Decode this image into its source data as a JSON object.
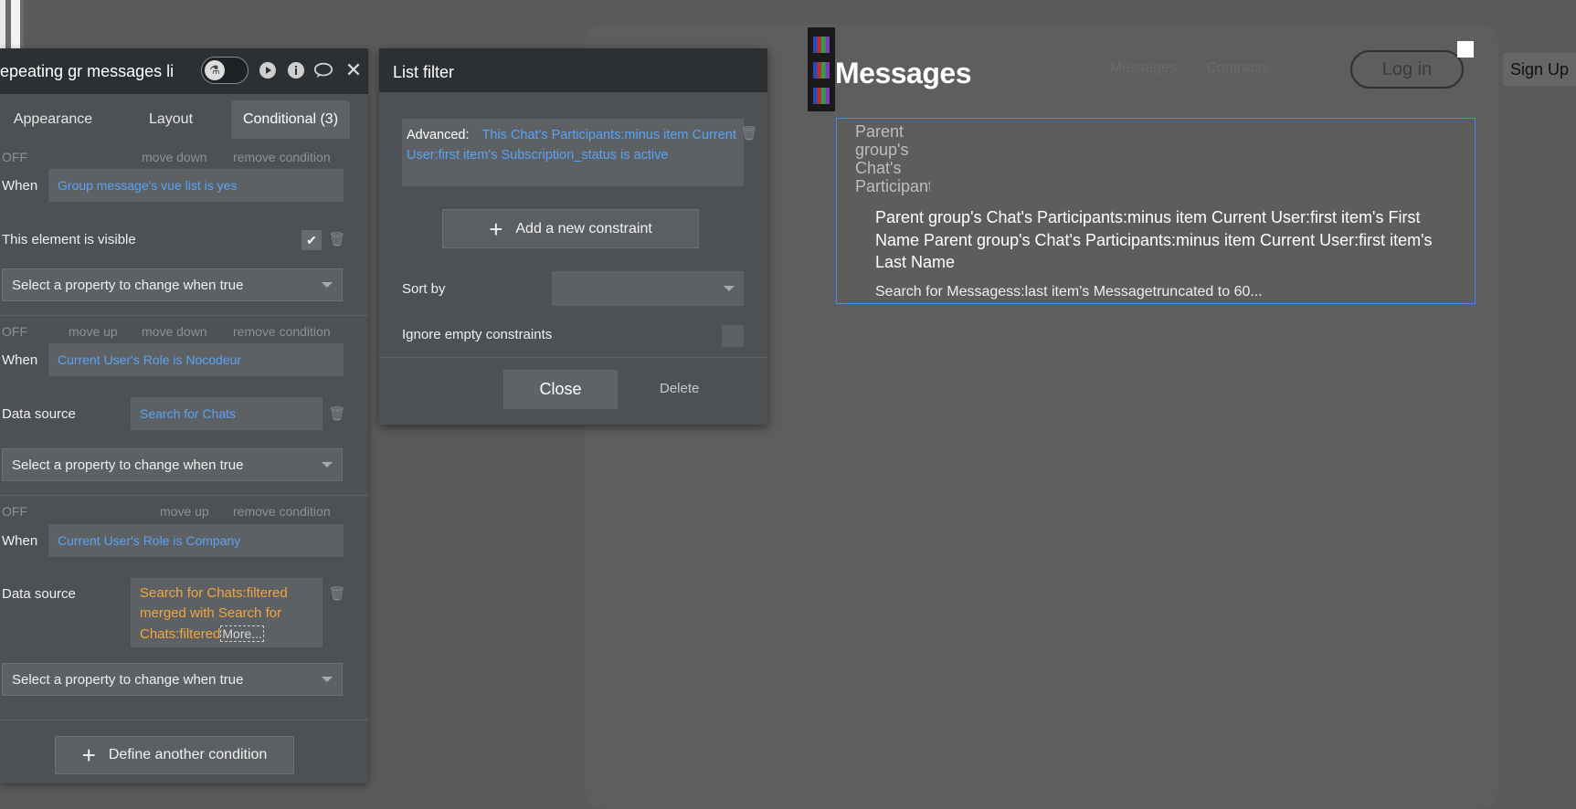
{
  "canvas": {
    "page_title": "Messages",
    "ghost_nav": [
      "Messages",
      "Contracts"
    ],
    "login_label": "Log in",
    "signup_label": "Sign Up",
    "avatar_alt": "Parent group's Chat's Participants",
    "message_name": "Parent group's Chat's Participants:minus item Current User:first item's First Name Parent group's Chat's Participants:minus item Current User:first item's Last Name",
    "message_preview": "Search for Messagess:last item's Messagetruncated to 60..."
  },
  "property_editor": {
    "title": "epeating gr messages li",
    "tabs": [
      "Appearance",
      "Layout",
      "Conditional (3)"
    ],
    "active_tab": "Conditional (3)",
    "conditions": [
      {
        "status": "OFF",
        "actions": [
          "move down",
          "remove condition"
        ],
        "when_label": "When",
        "when_expr": "Group message's vue list is yes",
        "property_label": "This element is visible",
        "property_checked": true,
        "select_placeholder": "Select a property to change when true"
      },
      {
        "status": "OFF",
        "actions": [
          "move up",
          "move down",
          "remove condition"
        ],
        "when_label": "When",
        "when_expr": "Current User's Role is Nocodeur",
        "property_label": "Data source",
        "property_value": "Search for Chats",
        "select_placeholder": "Select a property to change when true"
      },
      {
        "status": "OFF",
        "actions": [
          "move up",
          "remove condition"
        ],
        "when_label": "When",
        "when_expr": "Current User's Role is Company",
        "property_label": "Data source",
        "property_value": "Search for Chats:filtered merged with Search for Chats:filtered",
        "more_link": "More...",
        "select_placeholder": "Select a property to change when true"
      }
    ],
    "define_button": "Define another condition"
  },
  "list_filter": {
    "title": "List filter",
    "advanced_label": "Advanced:",
    "advanced_expr": "This Chat's Participants:minus item Current User:first item's Subscription_status is active",
    "add_constraint": "Add a new constraint",
    "sort_by_label": "Sort by",
    "sort_by_value": "",
    "ignore_label": "Ignore empty constraints",
    "ignore_checked": false,
    "close_label": "Close",
    "delete_label": "Delete"
  },
  "colors": {
    "accent_blue": "#5aa2f5",
    "accent_orange": "#f1a640",
    "panel_bg": "#4d5154",
    "header_bg": "#2c3033"
  }
}
